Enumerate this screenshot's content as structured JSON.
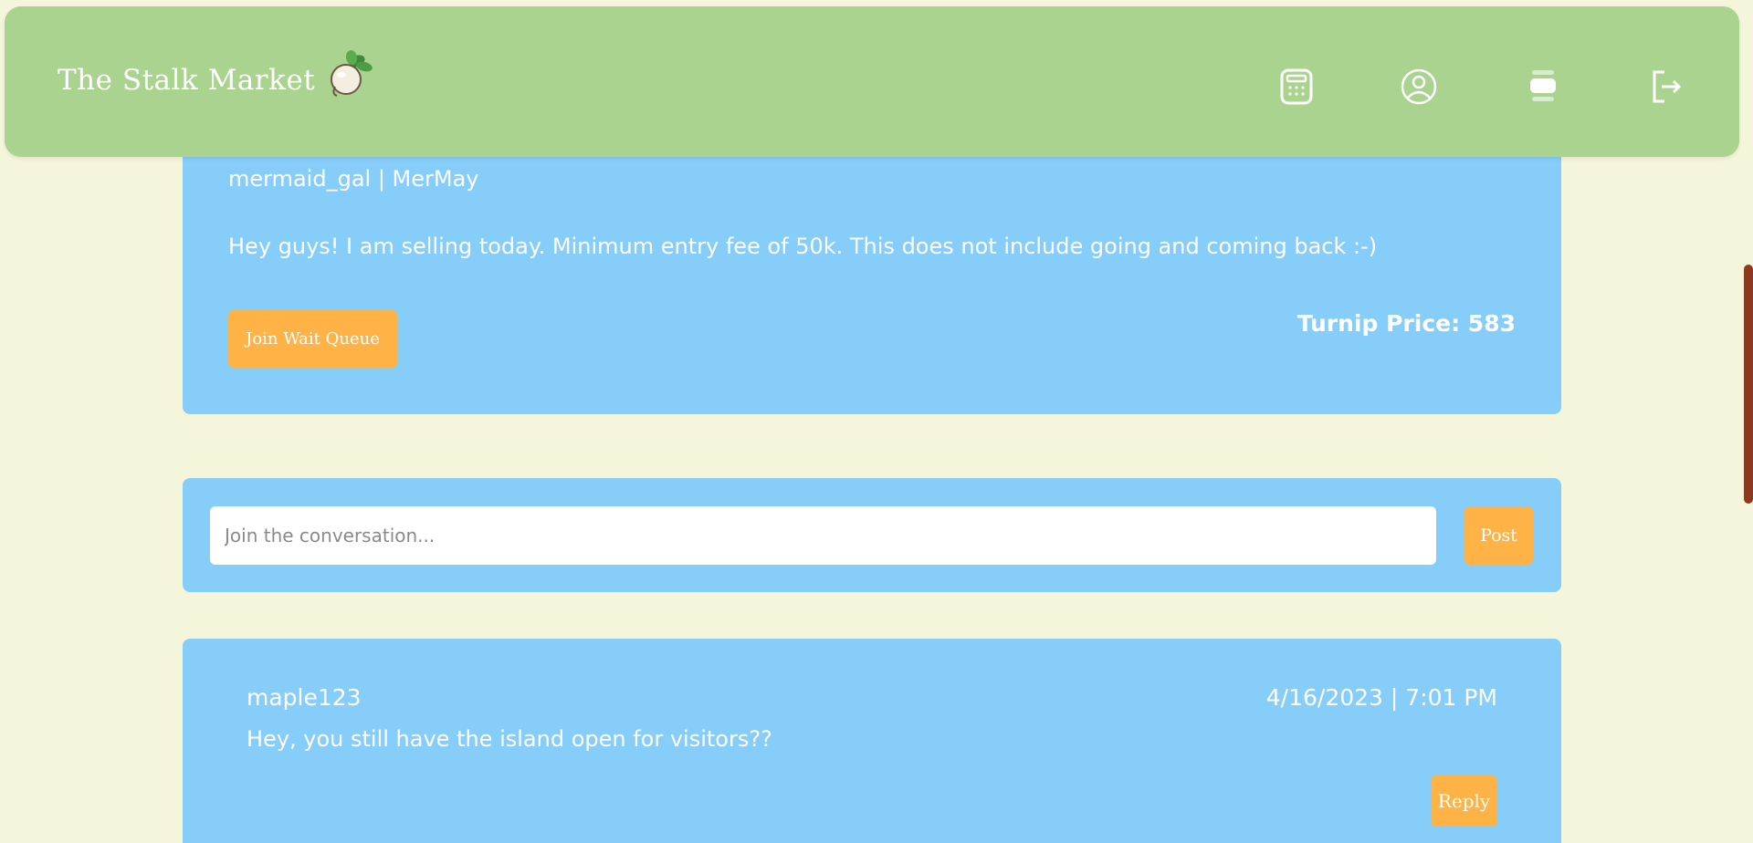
{
  "header": {
    "title": "The Stalk Market",
    "logo_icon": "turnip-icon",
    "nav": [
      {
        "name": "calculator",
        "icon": "calculator-icon"
      },
      {
        "name": "profile",
        "icon": "user-icon"
      },
      {
        "name": "posts",
        "icon": "posts-icon"
      },
      {
        "name": "logout",
        "icon": "logout-icon"
      }
    ]
  },
  "post": {
    "author": "mermaid_gal | MerMay",
    "body": "Hey guys! I am selling today. Minimum entry fee of 50k. This does not include going and coming back :-)",
    "join_button": "Join Wait Queue",
    "turnip_price": "Turnip Price: 583"
  },
  "comment_form": {
    "placeholder": "Join the conversation...",
    "post_button": "Post"
  },
  "replies": [
    {
      "author": "maple123",
      "timestamp": "4/16/2023 | 7:01 PM",
      "text": "Hey, you still have the island open for visitors??",
      "reply_button": "Reply"
    }
  ],
  "colors": {
    "header": "#a9d38f",
    "card": "#87cdf9",
    "button": "#ffb347",
    "background": "#f5f5dc",
    "scrollbar": "#8b3a1f"
  }
}
